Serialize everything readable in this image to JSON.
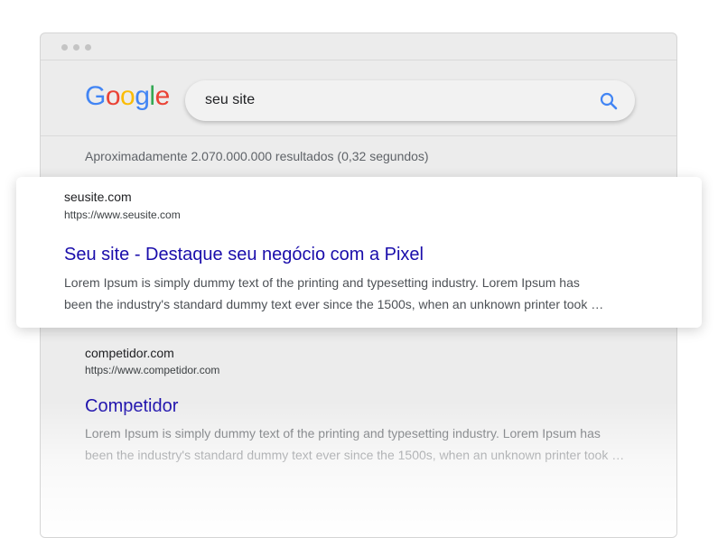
{
  "browser": {
    "window_controls": [
      "dot",
      "dot",
      "dot"
    ]
  },
  "header": {
    "logo": {
      "letters": [
        {
          "char": "G",
          "color": "#4285F4"
        },
        {
          "char": "o",
          "color": "#EA4335"
        },
        {
          "char": "o",
          "color": "#FBBC05"
        },
        {
          "char": "g",
          "color": "#4285F4"
        },
        {
          "char": "l",
          "color": "#34A853"
        },
        {
          "char": "e",
          "color": "#EA4335"
        }
      ]
    },
    "search": {
      "query": "seu site",
      "icon": "search-icon",
      "icon_color": "#4285F4"
    }
  },
  "results_stats": "Aproximadamente 2.070.000.000 resultados (0,32 segundos)",
  "results": [
    {
      "site": "seusite.com",
      "url": "https://www.seusite.com",
      "title": "Seu site - Destaque seu negócio com a Pixel",
      "snippet_line1": "Lorem Ipsum is simply dummy text of the printing and typesetting industry. Lorem Ipsum has",
      "snippet_line2": "been the industry's standard dummy text ever since the 1500s, when an unknown printer took …",
      "highlighted": true
    },
    {
      "site": "competidor.com",
      "url": "https://www.competidor.com",
      "title": "Competidor",
      "snippet_line1": "Lorem Ipsum is simply dummy text of the printing and typesetting industry. Lorem Ipsum has",
      "snippet_line2": "been the industry's standard dummy text ever since the 1500s, when an unknown printer took …",
      "highlighted": false
    }
  ],
  "colors": {
    "link": "#1a0dab",
    "window_bg": "#ececec",
    "card_bg": "#ffffff"
  }
}
